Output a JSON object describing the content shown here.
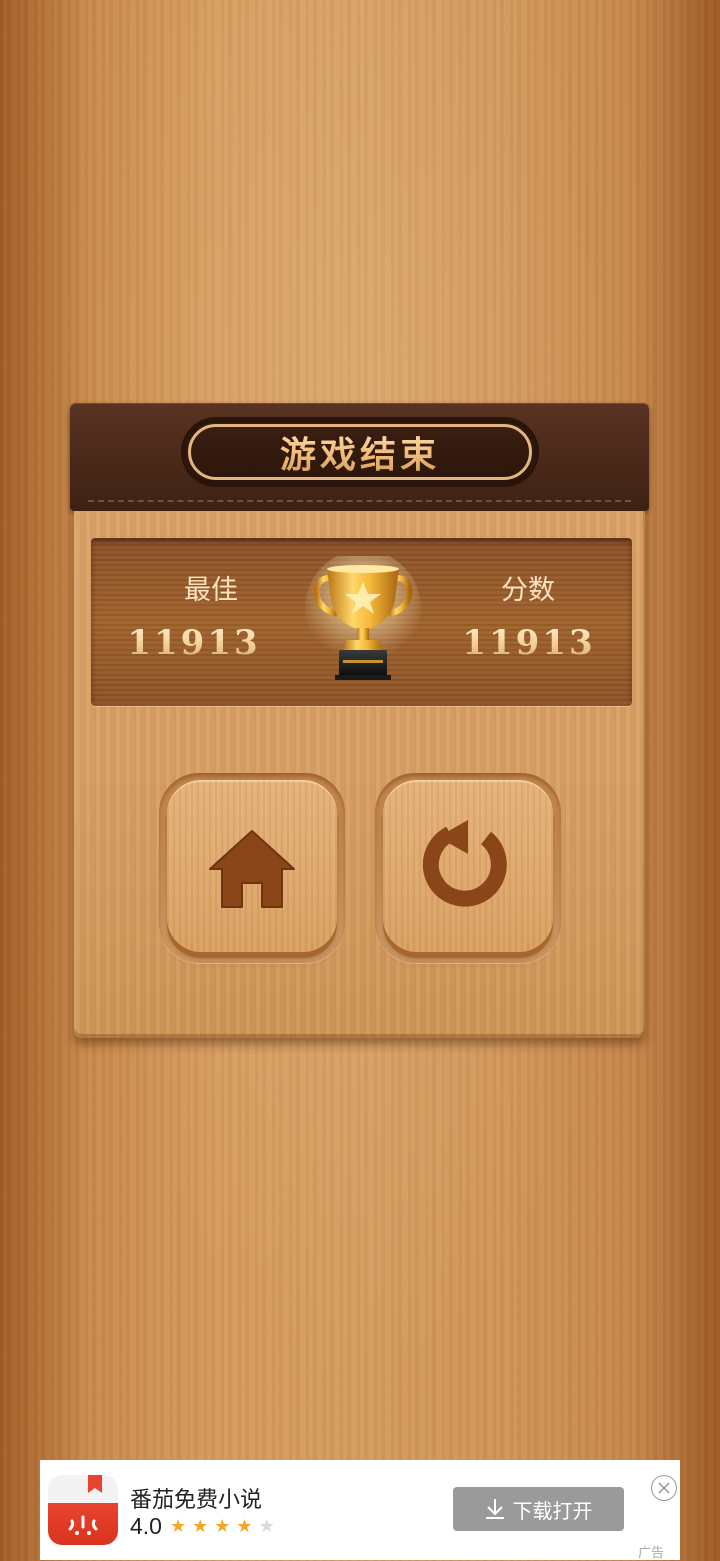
{
  "dialog": {
    "title": "游戏结束",
    "best_label": "最佳",
    "best_value": "11913",
    "score_label": "分数",
    "score_value": "11913",
    "home_icon": "home-icon",
    "restart_icon": "restart-icon"
  },
  "ad": {
    "app_name": "番茄免费小说",
    "rating": "4.0",
    "stars_filled": 4,
    "stars_total": 5,
    "cta_label": "下载打开",
    "tag": "广告"
  },
  "colors": {
    "title_gold": "#f2c07f",
    "ad_button": "#9a9a9a",
    "star_filled": "#f5a623",
    "star_empty": "#d9d9d9"
  }
}
